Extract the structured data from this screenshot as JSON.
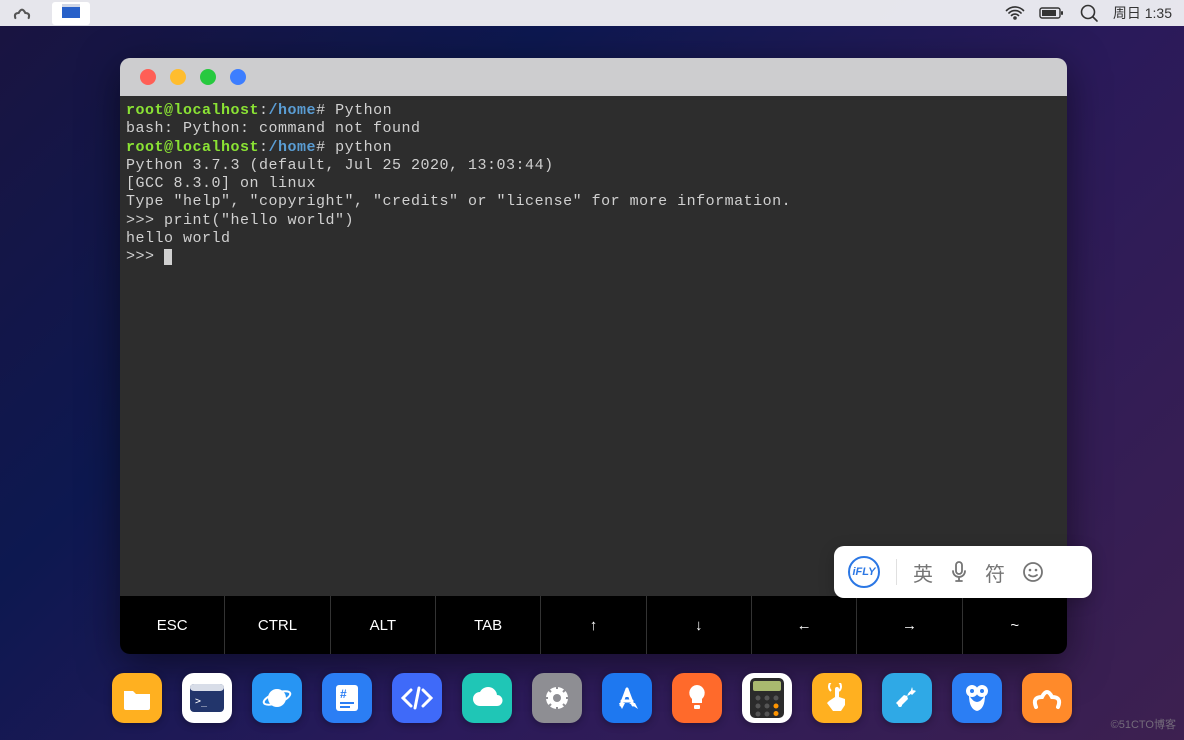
{
  "menubar": {
    "clock": "周日 1:35"
  },
  "terminal": {
    "lines": [
      {
        "type": "prompt",
        "user": "root@localhost",
        "sep": ":",
        "path": "/home",
        "hash": "#",
        "cmd": " Python"
      },
      {
        "type": "plain",
        "text": "bash: Python: command not found"
      },
      {
        "type": "prompt",
        "user": "root@localhost",
        "sep": ":",
        "path": "/home",
        "hash": "#",
        "cmd": " python"
      },
      {
        "type": "plain",
        "text": "Python 3.7.3 (default, Jul 25 2020, 13:03:44)"
      },
      {
        "type": "plain",
        "text": "[GCC 8.3.0] on linux"
      },
      {
        "type": "plain",
        "text": "Type \"help\", \"copyright\", \"credits\" or \"license\" for more information."
      },
      {
        "type": "plain",
        "text": ">>> print(\"hello world\")"
      },
      {
        "type": "plain",
        "text": "hello world"
      },
      {
        "type": "cursor",
        "text": ">>> "
      }
    ]
  },
  "keys": [
    "ESC",
    "CTRL",
    "ALT",
    "TAB",
    "↑",
    "↓",
    "←",
    "→",
    "~"
  ],
  "ime": {
    "logo": "iFLY",
    "lang": "英",
    "symbol": "符"
  },
  "dock": [
    {
      "name": "files-icon",
      "bg": "#ffb020",
      "glyph": "folder"
    },
    {
      "name": "terminal-icon",
      "bg": "#ffffff",
      "glyph": "terminal"
    },
    {
      "name": "browser-icon",
      "bg": "#2795f3",
      "glyph": "planet"
    },
    {
      "name": "code-tag-icon",
      "bg": "#2b7ef4",
      "glyph": "hashdoc"
    },
    {
      "name": "dev-icon",
      "bg": "#3f6af9",
      "glyph": "codetag"
    },
    {
      "name": "cloud-icon",
      "bg": "#1fc6b6",
      "glyph": "cloud"
    },
    {
      "name": "settings-icon",
      "bg": "#8e8e93",
      "glyph": "gear"
    },
    {
      "name": "appstore-icon",
      "bg": "#1e78f0",
      "glyph": "appstore"
    },
    {
      "name": "idea-icon",
      "bg": "#ff6a2b",
      "glyph": "bulb"
    },
    {
      "name": "calculator-icon",
      "bg": "#ffffff",
      "glyph": "calc"
    },
    {
      "name": "touch-icon",
      "bg": "#ffb020",
      "glyph": "touch"
    },
    {
      "name": "tools-icon",
      "bg": "#2fa9e6",
      "glyph": "wrench"
    },
    {
      "name": "mouse-icon",
      "bg": "#2b7ef4",
      "glyph": "mouse"
    },
    {
      "name": "aigo-icon",
      "bg": "#ff8a2a",
      "glyph": "aigo"
    }
  ],
  "watermark": "©51CTO博客"
}
